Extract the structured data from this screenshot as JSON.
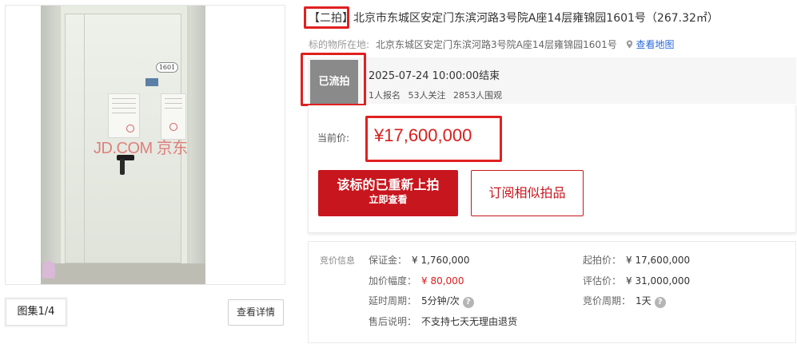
{
  "gallery": {
    "watermark": "JD.COM 京东",
    "door_number": "1601",
    "counter": "图集1/4",
    "details_button": "查看详情"
  },
  "listing": {
    "round_tag": "【二拍】",
    "title": "北京市东城区安定门东滨河路3号院A座14层雍锦园1601号（267.32㎡）",
    "address_label": "标的物所在地:",
    "address_value": "北京东城区安定门东滨河路3号院A座14层雍锦园1601号",
    "map_link": "查看地图",
    "icons": {
      "location": "map-pin-icon",
      "help": "question-mark-icon"
    }
  },
  "status": {
    "badge": "已流拍",
    "end_time": "2025-07-24 10:00:00结束",
    "signups": "1人报名",
    "followers": "53人关注",
    "viewers": "2853人围观"
  },
  "price": {
    "label": "当前价:",
    "value": "¥17,600,000"
  },
  "actions": {
    "relist_line1": "该标的已重新上拍",
    "relist_line2": "立即查看",
    "subscribe": "订阅相似拍品"
  },
  "bid_info": {
    "section_title": "竞价信息",
    "deposit_label": "保证金：",
    "deposit_value": "¥ 1,760,000",
    "increment_label": "加价幅度：",
    "increment_value": "¥ 80,000",
    "delay_label": "延时周期：",
    "delay_value": "5分钟/次",
    "after_sale_label": "售后说明：",
    "after_sale_value": "不支持七天无理由退货",
    "start_price_label": "起拍价：",
    "start_price_value": "¥ 17,600,000",
    "appraisal_label": "评估价：",
    "appraisal_value": "¥ 31,000,000",
    "bid_period_label": "竞价周期：",
    "bid_period_value": "1天"
  },
  "colors": {
    "accent_red": "#c8161e",
    "price_red": "#d81e1e",
    "highlight_red": "#e02020",
    "link_blue": "#2a6ad9",
    "badge_gray": "#8a8a8a"
  }
}
